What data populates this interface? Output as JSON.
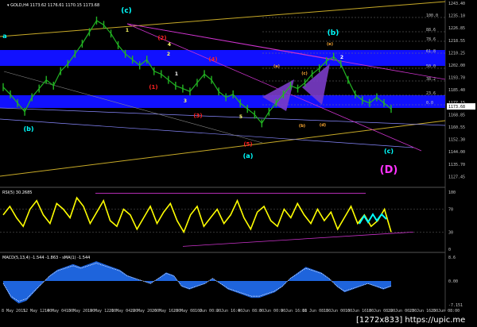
{
  "header": {
    "main": "▾ GOLD,H4  1173.62 1176.61 1170.15 1173.68",
    "rsi": "RSI(5) 30.2685",
    "macd": "MACD(5,13,4) -1.544 -1.863 - sMA(1) -1.544"
  },
  "colors": {
    "background": "#000000",
    "price_bars": "#22b422",
    "zone": "#1111ff",
    "rsi_line": "#ffff00",
    "macd_fill": "#1e64dc",
    "label_cyan": "#00ffff",
    "label_yellow": "#ffff66",
    "label_red": "#ff2222",
    "label_orange": "#ffaa33",
    "label_magenta": "#ff33ff",
    "channel_lines": "#c8aa28",
    "magenta_lines": "#cc33cc",
    "triangle_fill": "#7a3cc8"
  },
  "watermark": "[1272x833] https://upic.me",
  "chart_data": {
    "type": "line",
    "symbol": "GOLD",
    "timeframe": "H4",
    "price_axis_ticks": [
      "1243.40",
      "1235.10",
      "1226.85",
      "1218.55",
      "1210.25",
      "1202.00",
      "1193.70",
      "1185.40",
      "1177.15",
      "1168.85",
      "1160.55",
      "1152.30",
      "1144.00",
      "1135.70",
      "1127.45"
    ],
    "current_price": "1173.68",
    "date_labels": [
      "8 May 2015",
      "12 May 12:00",
      "14 May 04:00",
      "15 May 20:00",
      "19 May 12:00",
      "21 May 04:00",
      "22 May 20:00",
      "26 May 16:00",
      "28 May 08:00",
      "1 Jun 00:00",
      "2 Jun 16:00",
      "4 Jun 08:00",
      "8 Jun 00:00",
      "9 Jun 16:00",
      "11 Jun 08:00",
      "15 Jun 00:00",
      "16 Jun 16:00",
      "18 Jun 08:00",
      "22 Jun 00:00",
      "23 Jun 16:00",
      "25 Jun 08:00"
    ],
    "price_path": [
      1187,
      1182,
      1176,
      1170,
      1180,
      1186,
      1192,
      1188,
      1198,
      1203,
      1210,
      1217,
      1225,
      1233,
      1230,
      1224,
      1216,
      1210,
      1206,
      1202,
      1206,
      1198,
      1196,
      1192,
      1188,
      1186,
      1184,
      1190,
      1196,
      1192,
      1184,
      1180,
      1182,
      1176,
      1172,
      1168,
      1162,
      1170,
      1176,
      1182,
      1188,
      1186,
      1190,
      1196,
      1200,
      1205,
      1208,
      1203,
      1192,
      1182,
      1178,
      1176,
      1180,
      1176,
      1172
    ],
    "fib_levels": [
      "100.0",
      "88.6",
      "78.6",
      "61.8",
      "50.0",
      "38.2",
      "23.6",
      "0.0"
    ],
    "rsi": {
      "name": "RSI(5)",
      "value": 30.2685,
      "levels": [
        70,
        30
      ],
      "axis_ticks": [
        "100",
        "70",
        "30",
        "0"
      ],
      "values": [
        60,
        75,
        55,
        40,
        70,
        85,
        60,
        45,
        80,
        70,
        55,
        90,
        75,
        45,
        65,
        85,
        50,
        40,
        70,
        60,
        35,
        55,
        75,
        45,
        65,
        80,
        50,
        30,
        60,
        75,
        40,
        55,
        70,
        45,
        60,
        85,
        55,
        35,
        65,
        75,
        50,
        40,
        70,
        55,
        80,
        60,
        45,
        70,
        50,
        65,
        35,
        55,
        75,
        45,
        60,
        40,
        50,
        70,
        30
      ]
    },
    "macd": {
      "name": "MACD(5,13,4)",
      "value": -1.544,
      "signal": -1.863,
      "axis_ticks": [
        "8.6",
        "0.00",
        "-7.151"
      ],
      "values": [
        -1,
        -6,
        -8,
        -7,
        -4,
        -1,
        2,
        4,
        5,
        6,
        5,
        6,
        7,
        6,
        5,
        4,
        2,
        1,
        0,
        -1,
        1,
        3,
        2,
        -2,
        -3,
        -2,
        -1,
        1,
        -1,
        -3,
        -4,
        -5,
        -6,
        -6,
        -5,
        -4,
        -2,
        1,
        3,
        5,
        4,
        3,
        1,
        -2,
        -4,
        -3,
        -2,
        -1,
        -2,
        -3,
        -2
      ]
    },
    "wave_labels": [
      {
        "text": "a",
        "color": "cyan"
      },
      {
        "text": "(b)",
        "color": "cyan"
      },
      {
        "text": "(c)",
        "color": "cyan"
      },
      {
        "text": "(a)",
        "color": "cyan"
      },
      {
        "text": "(b)",
        "color": "cyan"
      },
      {
        "text": "(c)",
        "color": "cyan"
      },
      {
        "text": "(D)",
        "color": "magenta"
      },
      {
        "text": "(1)",
        "color": "red"
      },
      {
        "text": "(2)",
        "color": "red"
      },
      {
        "text": "(3)",
        "color": "red"
      },
      {
        "text": "(4)",
        "color": "red"
      },
      {
        "text": "(5)",
        "color": "red"
      },
      {
        "text": "(a)",
        "color": "orange"
      },
      {
        "text": "(b)",
        "color": "orange"
      },
      {
        "text": "(c)",
        "color": "orange"
      },
      {
        "text": "(d)",
        "color": "orange"
      },
      {
        "text": "(e)",
        "color": "orange"
      },
      {
        "text": "1",
        "color": "yellow"
      },
      {
        "text": "2",
        "color": "yellow"
      },
      {
        "text": "3",
        "color": "yellow"
      },
      {
        "text": "4",
        "color": "yellow"
      },
      {
        "text": "5",
        "color": "yellow"
      },
      {
        "text": "2",
        "color": "white"
      },
      {
        "text": "1",
        "color": "white"
      }
    ]
  }
}
